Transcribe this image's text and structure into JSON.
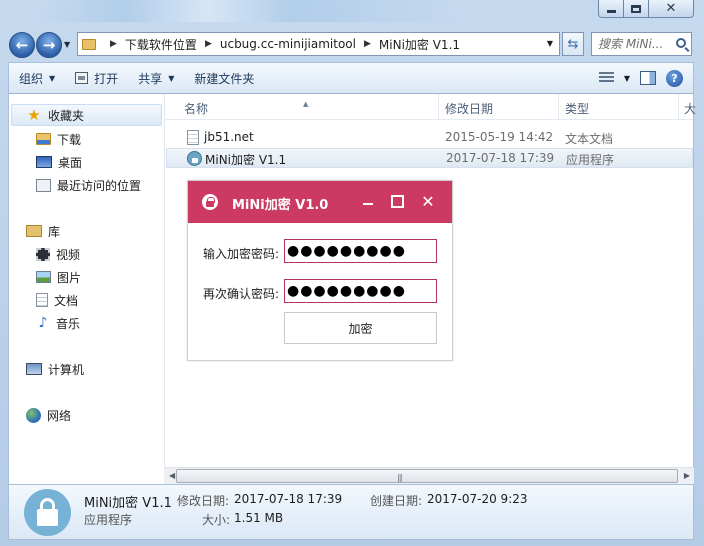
{
  "window": {
    "caption_min": "",
    "caption_max": "",
    "caption_close": "✕"
  },
  "address": {
    "crumbs": [
      "下载软件位置",
      "ucbug.cc-minijiamitool",
      "MiNi加密 V1.1"
    ],
    "search_placeholder": "搜索 MiNi..."
  },
  "toolbar": {
    "organize": "组织",
    "open": "打开",
    "share": "共享",
    "new_folder": "新建文件夹",
    "help": "?"
  },
  "nav": {
    "favorites": "收藏夹",
    "downloads": "下载",
    "desktop": "桌面",
    "recent": "最近访问的位置",
    "libraries": "库",
    "videos": "视频",
    "pictures": "图片",
    "documents": "文档",
    "music": "音乐",
    "computer": "计算机",
    "network": "网络"
  },
  "columns": {
    "name": "名称",
    "date": "修改日期",
    "type": "类型",
    "size": "大"
  },
  "files": [
    {
      "name": "jb51.net",
      "date": "2015-05-19 14:42",
      "type": "文本文档"
    },
    {
      "name": "MiNi加密 V1.1",
      "date": "2017-07-18 17:39",
      "type": "应用程序"
    }
  ],
  "details": {
    "name": "MiNi加密 V1.1",
    "kind": "应用程序",
    "modified_label": "修改日期:",
    "modified_value": "2017-07-18 17:39",
    "created_label": "创建日期:",
    "created_value": "2017-07-20 9:23",
    "size_label": "大小:",
    "size_value": "1.51 MB"
  },
  "dialog": {
    "title": "MiNi加密 V1.0",
    "min": "",
    "max": "",
    "close": "✕",
    "password_label": "输入加密密码:",
    "password_value": "●●●●●●●●●",
    "confirm_label": "再次确认密码:",
    "confirm_value": "●●●●●●●●●",
    "encrypt_button": "加密"
  },
  "colors": {
    "dialog_accent": "#cc3a64",
    "explorer_chrome": "#c5d9ee"
  }
}
